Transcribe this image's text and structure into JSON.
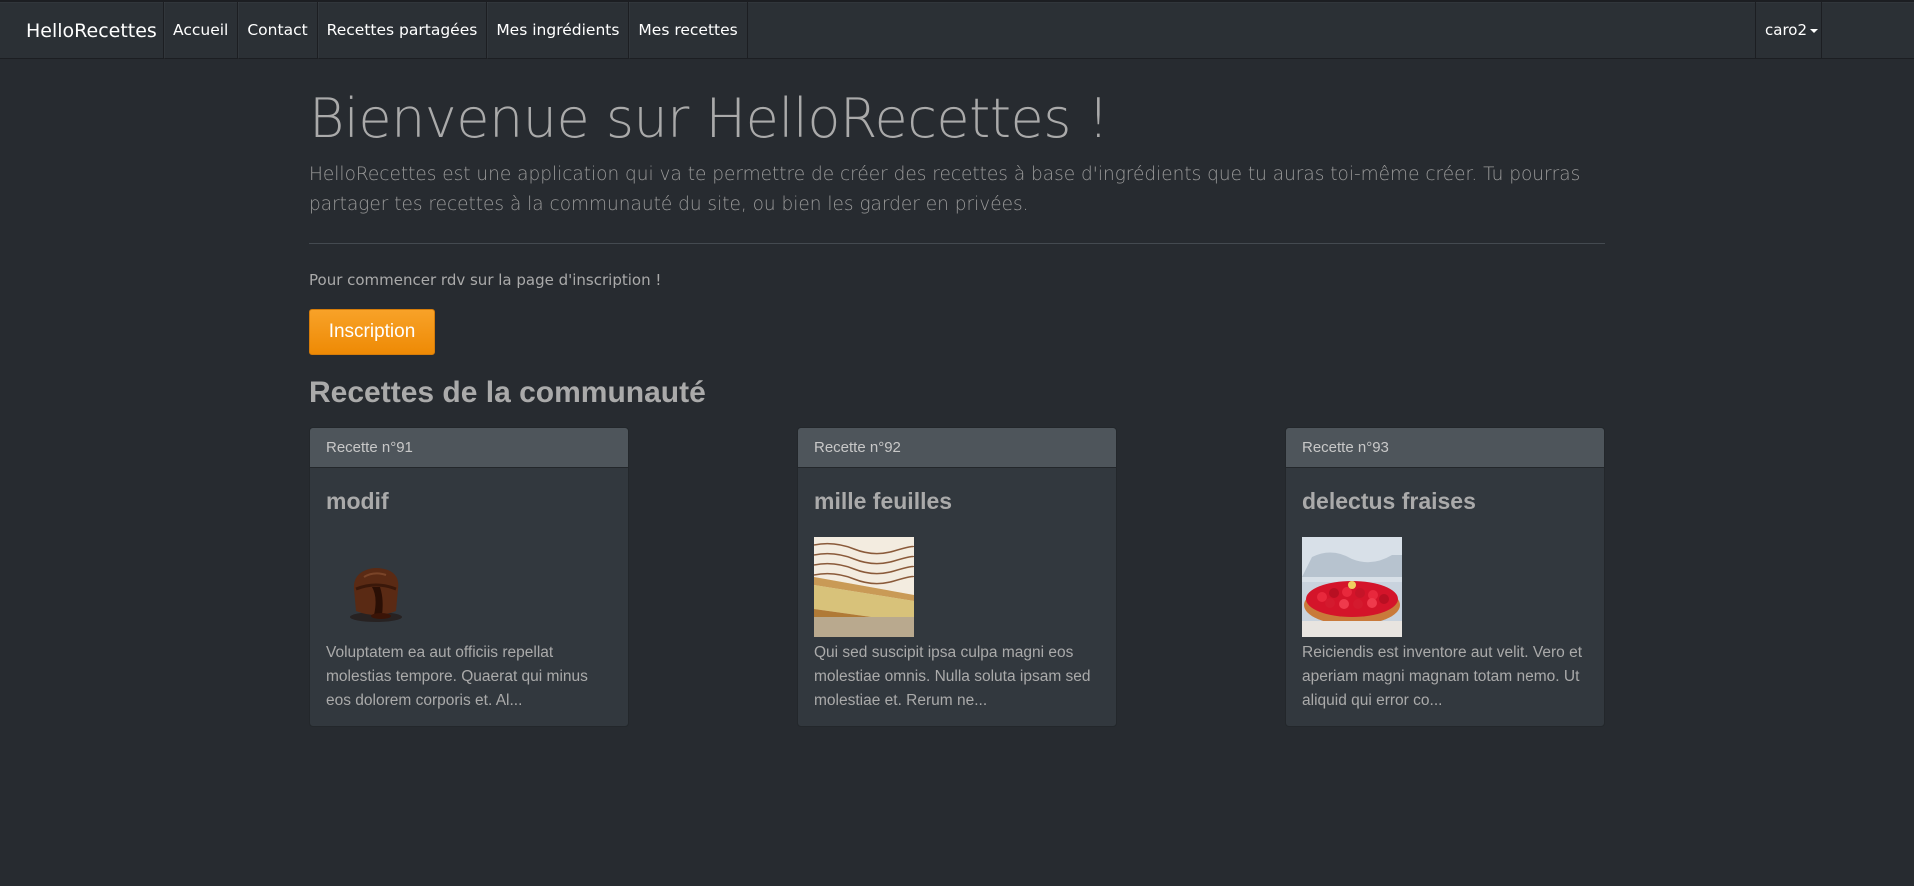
{
  "navbar": {
    "brand": "HelloRecettes",
    "links": [
      "Accueil",
      "Contact",
      "Recettes partagées",
      "Mes ingrédients",
      "Mes recettes"
    ],
    "user": "caro2"
  },
  "hero": {
    "title": "Bienvenue sur HelloRecettes !",
    "lead": "HelloRecettes est une application qui va te permettre de créer des recettes à base d'ingrédients que tu auras toi-même créer. Tu pourras partager tes recettes à la communauté du site, ou bien les garder en privées.",
    "start_text": "Pour commencer rdv sur la page d'inscription !",
    "signup_label": "Inscription"
  },
  "community": {
    "title": "Recettes de la communauté",
    "cards": [
      {
        "header": "Recette n°91",
        "name": "modif",
        "image": "chocolate-lava-cake",
        "excerpt": "Voluptatem ea aut officiis repellat molestias tempore. Quaerat qui minus eos dolorem corporis et. Al..."
      },
      {
        "header": "Recette n°92",
        "name": "mille feuilles",
        "image": "mille-feuille-pastry",
        "excerpt": "Qui sed suscipit ipsa culpa magni eos molestiae omnis. Nulla soluta ipsam sed molestiae et. Rerum ne..."
      },
      {
        "header": "Recette n°93",
        "name": "delectus fraises",
        "image": "strawberry-tart",
        "excerpt": "Reiciendis est inventore aut velit. Vero et aperiam magni magnam totam nemo. Ut aliquid qui error co..."
      }
    ]
  },
  "colors": {
    "background": "#272b30",
    "navbar": "#2b3035",
    "accent": "#f39c12",
    "card": "#32383e",
    "card_header": "#4e555b"
  }
}
